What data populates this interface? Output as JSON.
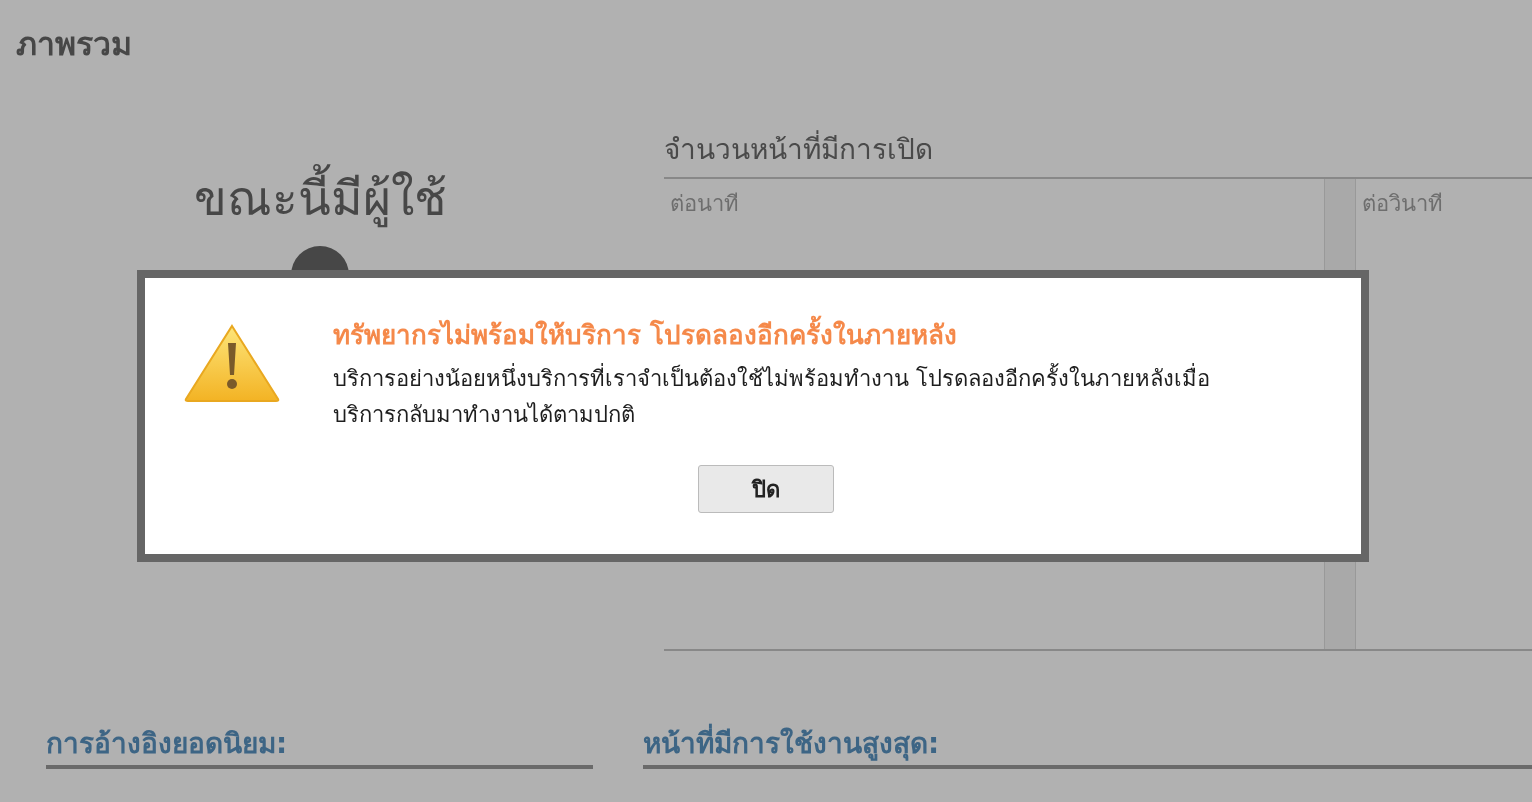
{
  "page": {
    "title": "ภาพรวม"
  },
  "active_users": {
    "title": "ขณะนี้มีผู้ใช้"
  },
  "page_views": {
    "title": "จำนวนหน้าที่มีการเปิด",
    "columns": [
      "ต่อนาที",
      "ต่อวินาที"
    ]
  },
  "sections": [
    {
      "title": "การอ้างอิงยอดนิยม:"
    },
    {
      "title": "หน้าที่มีการใช้งานสูงสุด:"
    }
  ],
  "dialog": {
    "title": "ทรัพยากรไม่พร้อมให้บริการ โปรดลองอีกครั้งในภายหลัง",
    "message": "บริการอย่างน้อยหนึ่งบริการที่เราจำเป็นต้องใช้ไม่พร้อมทำงาน โปรดลองอีกครั้งในภายหลังเมื่อบริการกลับมาทำงานได้ตามปกติ",
    "buttons": [
      "ปิด"
    ]
  }
}
